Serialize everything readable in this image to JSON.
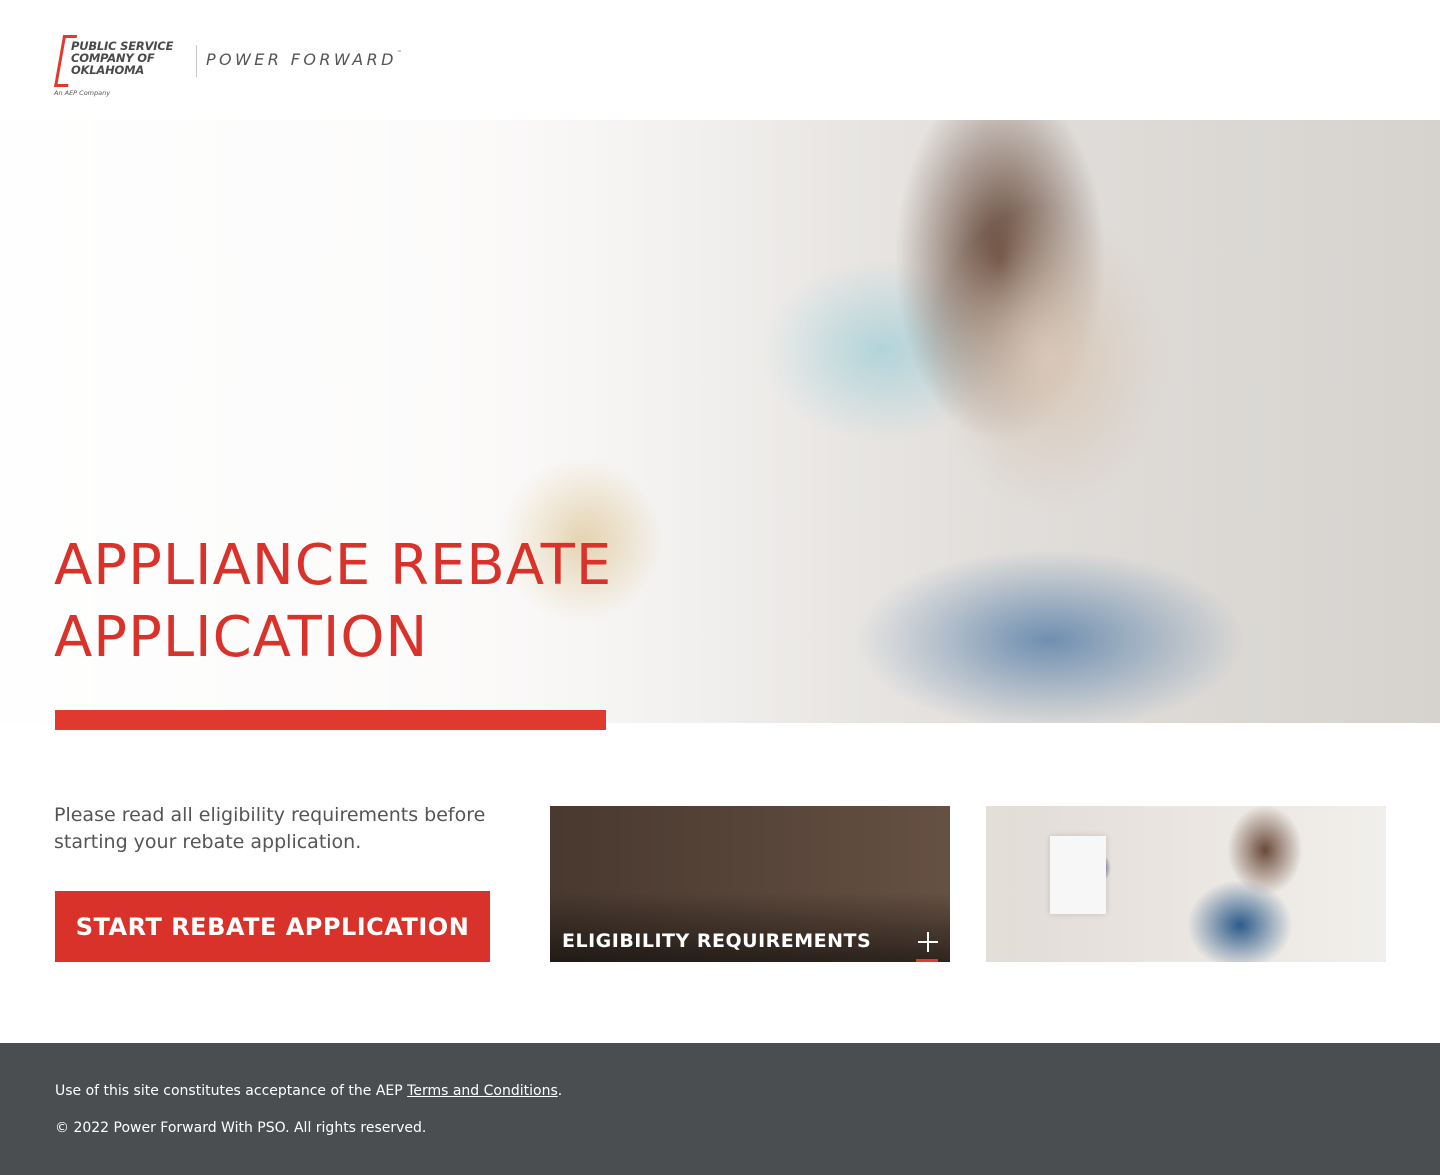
{
  "brand": {
    "logo_lines": [
      "PUBLIC SERVICE",
      "COMPANY OF",
      "OKLAHOMA"
    ],
    "logo_sub": "An AEP Company",
    "tagline": "POWER FORWARD",
    "tagline_mark": "™",
    "accent_color": "#e03a2f"
  },
  "hero": {
    "title_line1": "APPLIANCE REBATE",
    "title_line2": "APPLICATION"
  },
  "intro": {
    "text": "Please read all eligibility requirements before starting your rebate application.",
    "cta_label": "START REBATE APPLICATION"
  },
  "cards": {
    "eligibility_label": "ELIGIBILITY REQUIREMENTS",
    "eligibility_icon": "plus-icon"
  },
  "footer": {
    "line1_prefix": "Use of this site constitutes acceptance of the AEP ",
    "terms_link": "Terms and Conditions",
    "line1_suffix": ".",
    "copyright": "© 2022 Power Forward With PSO. All rights reserved.",
    "background_color": "#4b4e51"
  }
}
